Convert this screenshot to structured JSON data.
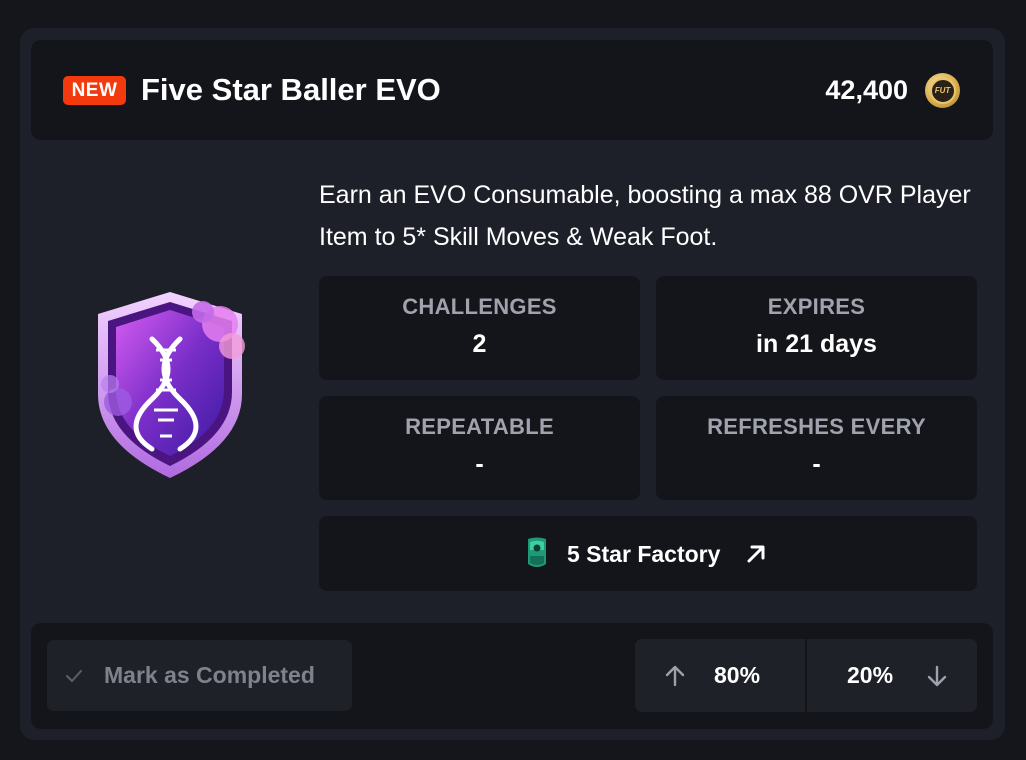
{
  "header": {
    "badge": "NEW",
    "title": "Five Star Baller EVO",
    "price": "42,400",
    "coin_label": "FUT",
    "coin_icon": "fut-coin-icon"
  },
  "emblem_icon": "dna-shield-emblem",
  "description": "Earn an EVO Consumable, boosting a max 88 OVR Player Item to 5* Skill Moves & Weak Foot.",
  "stats": [
    {
      "label": "CHALLENGES",
      "value": "2"
    },
    {
      "label": "EXPIRES",
      "value": "in 21 days"
    },
    {
      "label": "REPEATABLE",
      "value": "-"
    },
    {
      "label": "REFRESHES EVERY",
      "value": "-"
    }
  ],
  "link": {
    "label": "5 Star Factory",
    "icon": "evo-card-icon",
    "arrow_icon": "arrow-up-right-icon"
  },
  "footer": {
    "mark_label": "Mark as Completed",
    "mark_icon": "check-icon",
    "upvote_pct": "80%",
    "downvote_pct": "20%",
    "upvote_icon": "arrow-up-icon",
    "downvote_icon": "arrow-down-icon"
  },
  "colors": {
    "background": "#15161c",
    "card": "#1e2029",
    "panel": "#14151b",
    "badge": "#f23a0e",
    "muted_text": "#a0a3ae"
  }
}
